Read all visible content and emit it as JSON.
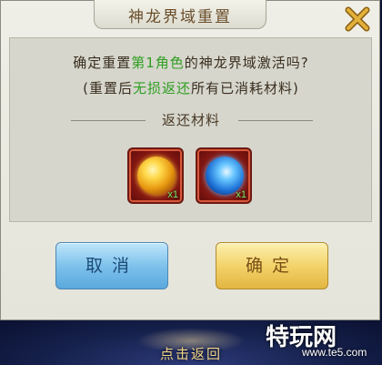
{
  "dialog": {
    "title": "神龙界域重置",
    "confirm_prefix": "确定重置",
    "confirm_highlight": "第1角色",
    "confirm_suffix": "的神龙界域激活吗?",
    "note_prefix": "(重置后",
    "note_highlight": "无损返还",
    "note_suffix": "所有已消耗材料)",
    "refund_label": "返还材料",
    "items": [
      {
        "name": "gold-dragon-orb",
        "qty": "x1"
      },
      {
        "name": "blue-dragon-orb",
        "qty": "x1"
      }
    ],
    "cancel_label": "取消",
    "ok_label": "确定",
    "close_icon": "close-x-icon"
  },
  "background": {
    "bottom_hint": "点击返回"
  },
  "watermark": {
    "brand": "特玩网",
    "url": "www.te5.com"
  },
  "colors": {
    "highlight_green": "#2f9e22",
    "title_brown": "#6a4e2b",
    "close_gold": "#d9a52c"
  }
}
